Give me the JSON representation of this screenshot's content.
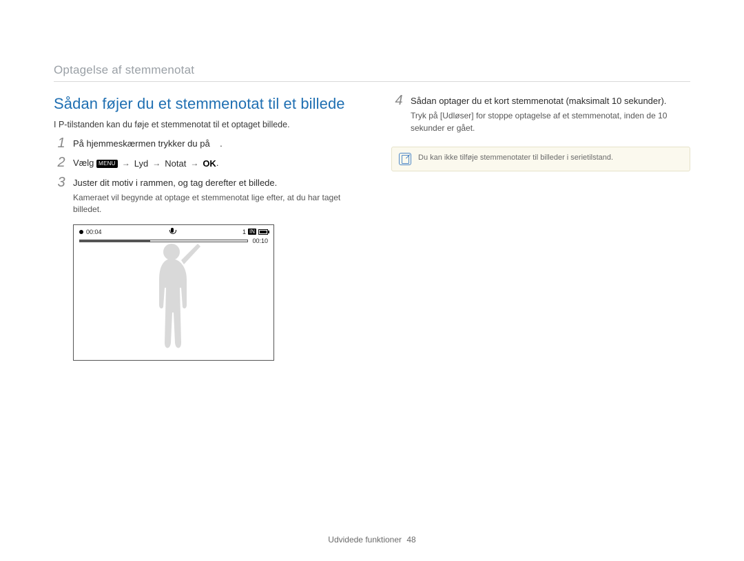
{
  "breadcrumb": "Optagelse af stemmenotat",
  "left": {
    "title": "Sådan føjer du et stemmenotat til et billede",
    "intro": "I P-tilstanden kan du føje et stemmenotat til et optaget billede.",
    "steps": {
      "s1": "På hjemmeskærmen trykker du på",
      "s2_prefix": "Vælg",
      "s2_menu": "MENU",
      "s2_a": "Lyd",
      "s2_b": "Notat",
      "s2_ok": "OK",
      "s2_period": ".",
      "s3": "Juster dit motiv i rammen, og tag derefter et billede.",
      "s3_sub": "Kameraet vil begynde at optage et stemmenotat lige efter, at du har taget billedet."
    },
    "camera": {
      "elapsed": "00:04",
      "total": "00:10",
      "count": "1",
      "memory_badge": "IN"
    }
  },
  "right": {
    "s4_num": "4",
    "s4_text": "Sådan optager du et kort stemmenotat (maksimalt 10 sekunder).",
    "s4_sub_prefix": "Tryk på ",
    "s4_sub_key": "Udløser",
    "s4_sub_suffix": " for stoppe optagelse af et stemmenotat, inden de 10 sekunder er gået.",
    "note": "Du kan ikke tilføje stemmenotater til billeder i serietilstand."
  },
  "footer": {
    "section": "Udvidede funktioner",
    "page": "48"
  },
  "glyphs": {
    "arrow": "→"
  }
}
